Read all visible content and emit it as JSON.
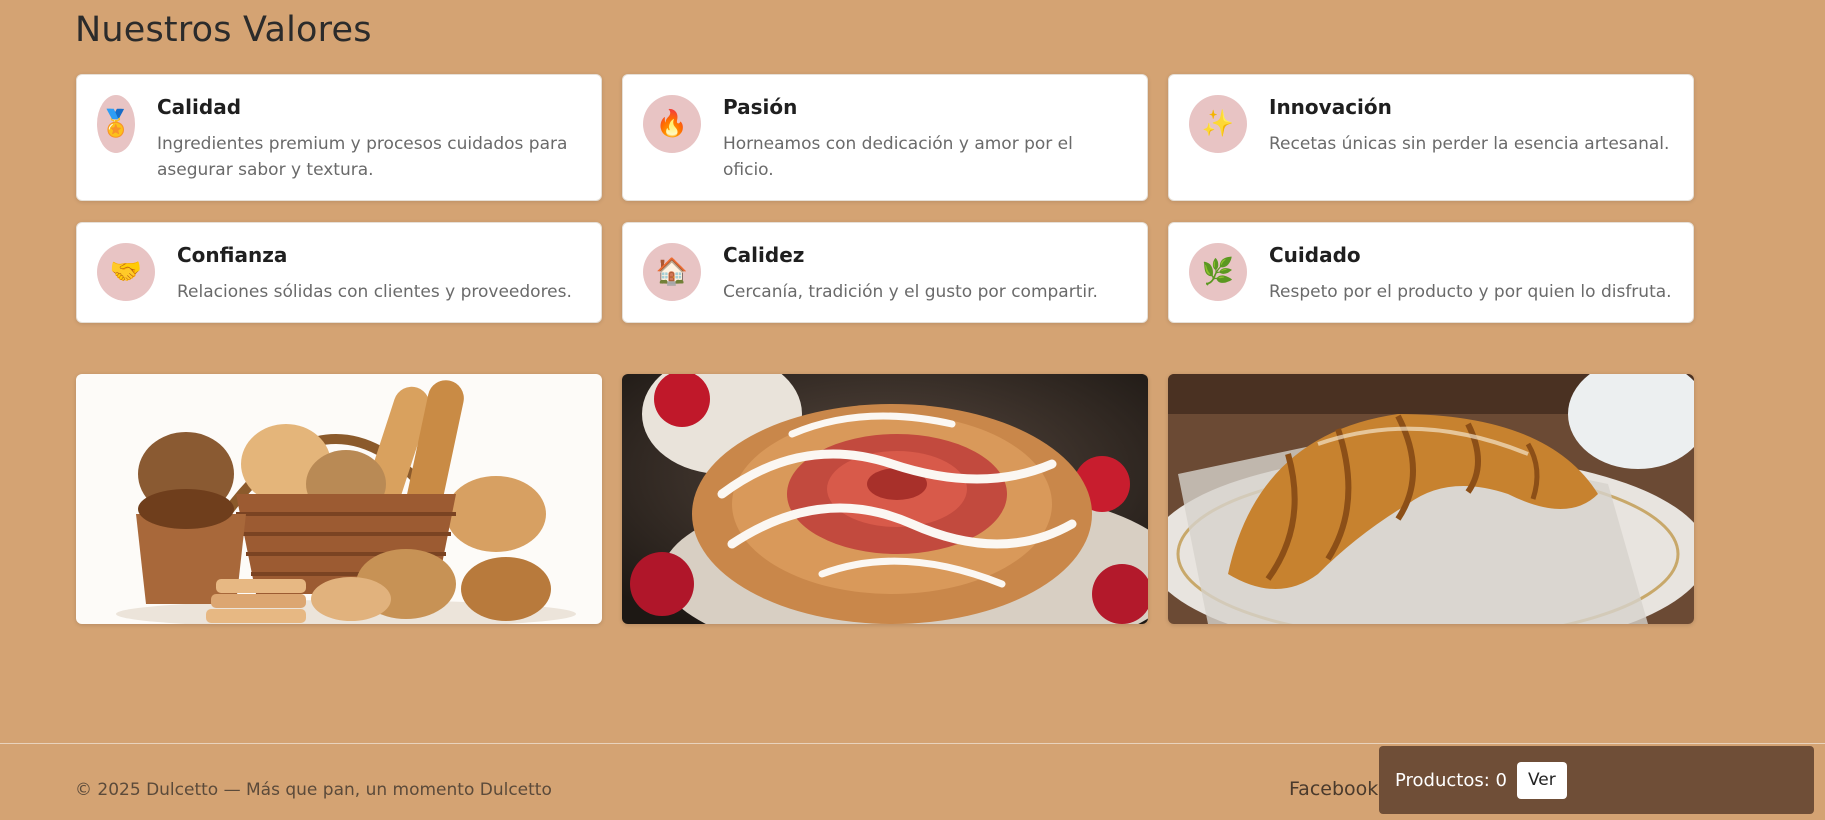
{
  "section": {
    "title": "Nuestros Valores"
  },
  "values": [
    {
      "title": "Calidad",
      "text": "Ingredientes premium y procesos cuidados para asegurar sabor y textura.",
      "icon": "medal-icon",
      "glyph": "🏅"
    },
    {
      "title": "Pasión",
      "text": "Horneamos con dedicación y amor por el oficio.",
      "icon": "fire-icon",
      "glyph": "🔥"
    },
    {
      "title": "Innovación",
      "text": "Recetas únicas sin perder la esencia artesanal.",
      "icon": "sparkles-icon",
      "glyph": "✨"
    },
    {
      "title": "Confianza",
      "text": "Relaciones sólidas con clientes y proveedores.",
      "icon": "handshake-icon",
      "glyph": "🤝"
    },
    {
      "title": "Calidez",
      "text": "Cercanía, tradición y el gusto por compartir.",
      "icon": "house-icon",
      "glyph": "🏠"
    },
    {
      "title": "Cuidado",
      "text": "Respeto por el producto y por quien lo disfruta.",
      "icon": "herb-icon",
      "glyph": "🌿"
    }
  ],
  "gallery": [
    {
      "name": "bread-basket-image"
    },
    {
      "name": "cinnamon-roll-image"
    },
    {
      "name": "croissant-image"
    }
  ],
  "footer": {
    "copyright": "© 2025 Dulcetto — Más que pan, un momento Dulcetto",
    "social": "Facebook"
  },
  "cart": {
    "label": "Productos: 0",
    "button": "Ver"
  },
  "colors": {
    "background": "#d4a373",
    "card": "#ffffff",
    "icon_bg": "#e8c4c4",
    "cart_bar": "#6f4e37"
  }
}
